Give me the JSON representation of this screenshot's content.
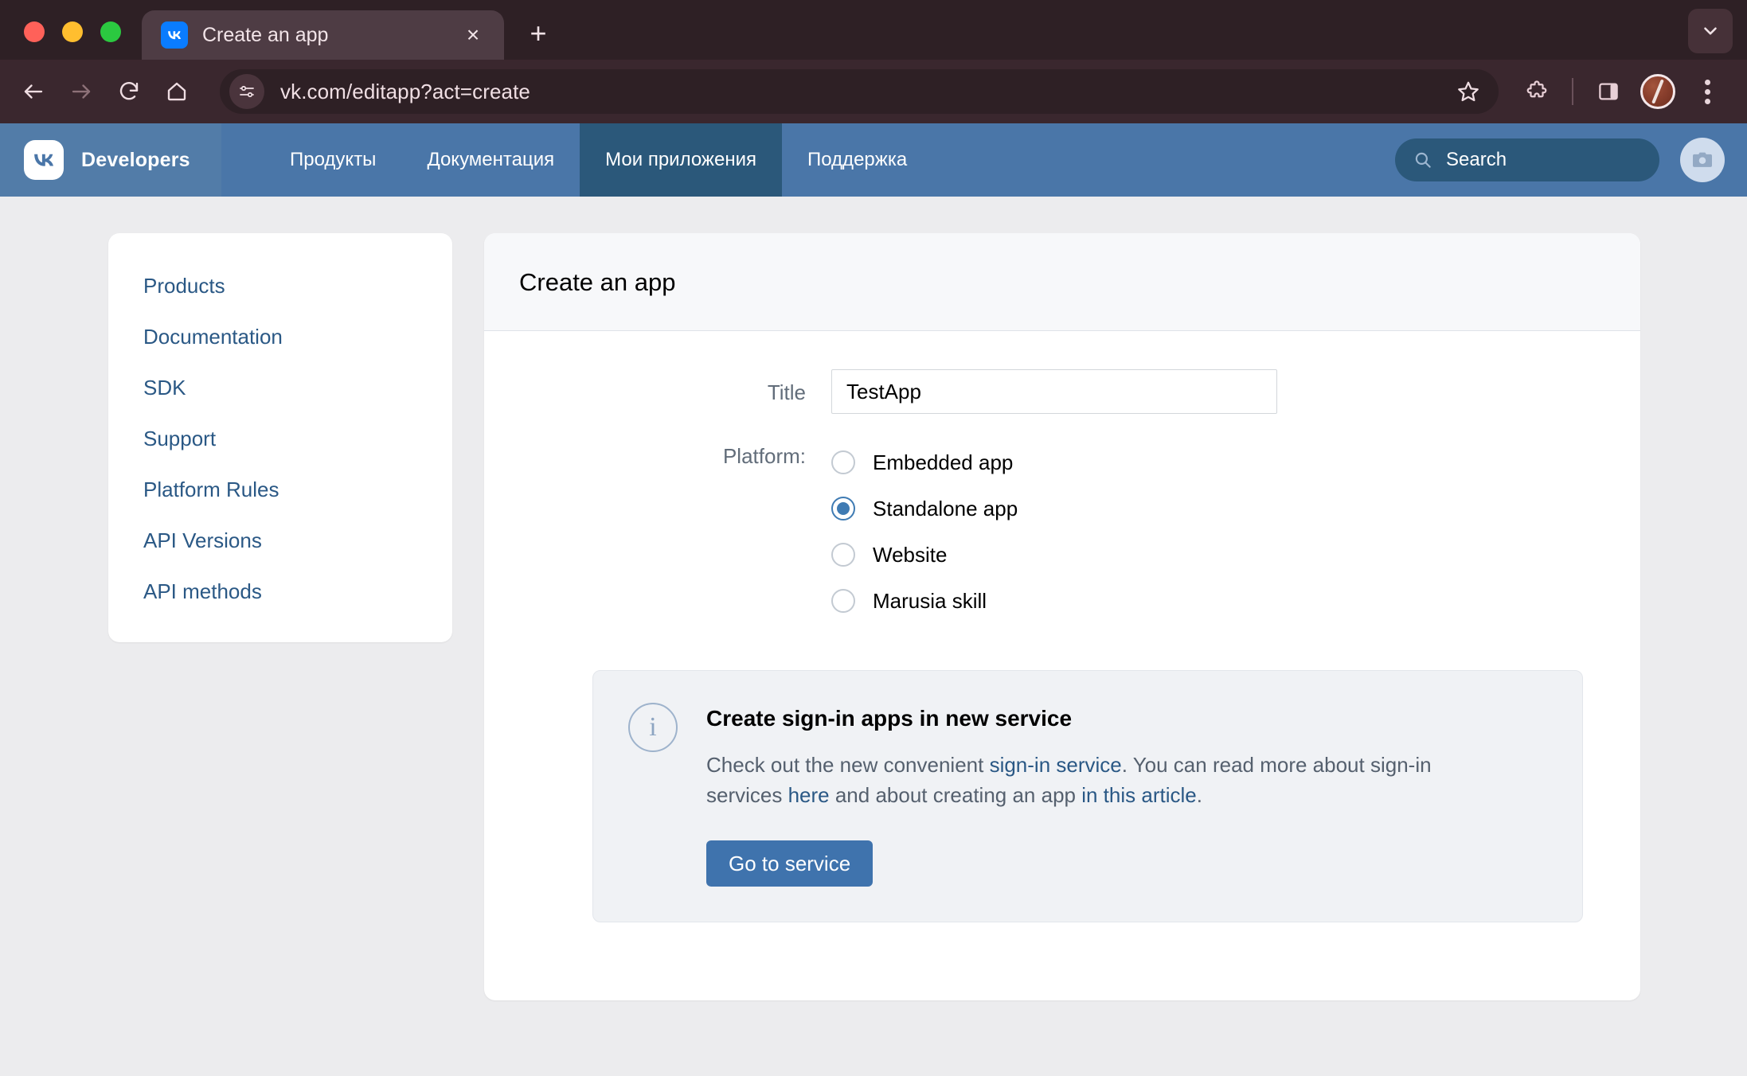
{
  "browser": {
    "tab": {
      "title": "Create an app",
      "favicon": "vk-favicon-icon",
      "close": "×"
    },
    "new_tab_label": "+",
    "tab_list_chevron": "chevron-down-icon",
    "url": "vk.com/editapp?act=create",
    "nav": {
      "back": "back-arrow-icon",
      "forward": "forward-arrow-icon",
      "reload": "reload-icon",
      "home": "home-icon"
    },
    "omnibox_icon": "site-settings-icon",
    "bookmark_icon": "star-icon",
    "extensions_icon": "extensions-puzzle-icon",
    "side_panel_icon": "side-panel-icon",
    "profile_icon": "profile-avatar",
    "menu_icon": "three-dot-menu-icon"
  },
  "vk_header": {
    "brand": "Developers",
    "logo_icon": "vk-logo-icon",
    "nav": [
      {
        "label": "Продукты",
        "active": false
      },
      {
        "label": "Документация",
        "active": false
      },
      {
        "label": "Мои приложения",
        "active": true
      },
      {
        "label": "Поддержка",
        "active": false
      }
    ],
    "search": {
      "placeholder": "Search",
      "icon": "search-icon"
    },
    "avatar_icon": "camera-avatar-icon",
    "colors": {
      "header_bg": "#4a76a8",
      "logo_bg": "#527ca8",
      "active_tab_bg": "#2b587a"
    }
  },
  "sidebar": {
    "items": [
      {
        "label": "Products"
      },
      {
        "label": "Documentation"
      },
      {
        "label": "SDK"
      },
      {
        "label": "Support"
      },
      {
        "label": "Platform Rules"
      },
      {
        "label": "API Versions"
      },
      {
        "label": "API methods"
      }
    ]
  },
  "main": {
    "heading": "Create an app",
    "form": {
      "title_label": "Title",
      "title_value": "TestApp",
      "title_placeholder": "",
      "platform_label": "Platform:",
      "platform_options": [
        {
          "label": "Embedded app",
          "checked": false
        },
        {
          "label": "Standalone app",
          "checked": true
        },
        {
          "label": "Website",
          "checked": false
        },
        {
          "label": "Marusia skill",
          "checked": false
        }
      ]
    },
    "notice": {
      "icon": "info-circle-icon",
      "title": "Create sign-in apps in new service",
      "text_part1": "Check out the new convenient ",
      "link1": "sign-in service",
      "text_part2": ". You can read more about sign-in services ",
      "link2": "here",
      "text_part3": " and about creating an app ",
      "link3": "in this article",
      "text_part4": ".",
      "button_label": "Go to service"
    }
  },
  "colors": {
    "accent": "#2a5885",
    "button": "#3f73ad",
    "page_bg": "#ececee",
    "radio_checked": "#3f7bb3"
  }
}
